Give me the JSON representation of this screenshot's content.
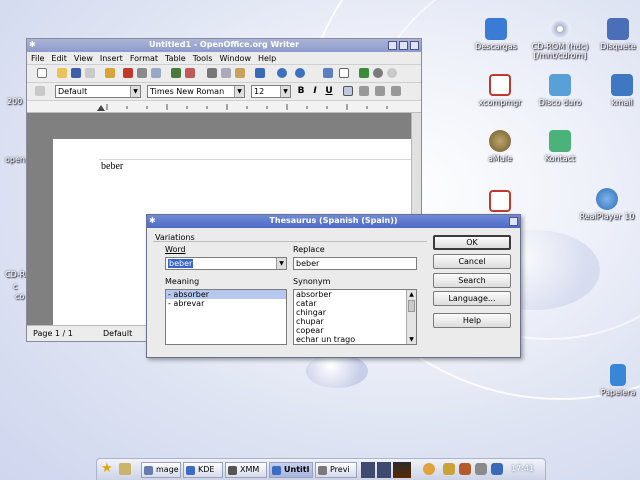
{
  "desktop": {
    "icons": [
      {
        "label": "Descargas",
        "icon": "folder-download-icon",
        "color": "#3a7bd5"
      },
      {
        "label": "CD-ROM (hdc)\n[/mnt/cdrom]",
        "icon": "cdrom-icon",
        "color": "#8aa0c8"
      },
      {
        "label": "Disquete",
        "icon": "floppy-icon",
        "color": "#4a6fb8"
      },
      {
        "label": "xcompmgr",
        "icon": "app-icon",
        "color": "#c0392b"
      },
      {
        "label": "Disco duro",
        "icon": "harddisk-icon",
        "color": "#5aa0d8"
      },
      {
        "label": "kmail",
        "icon": "mail-icon",
        "color": "#3e78c2"
      },
      {
        "label": "aMule",
        "icon": "mule-icon",
        "color": "#7a6a3a"
      },
      {
        "label": "Kontact",
        "icon": "kontact-icon",
        "color": "#4bb37a"
      },
      {
        "label": "RealPlayer 10",
        "icon": "realplayer-icon",
        "color": "#2d6fb7"
      },
      {
        "label": "Papelera",
        "icon": "trash-icon",
        "color": "#3a86d6"
      }
    ],
    "edge_labels": [
      "200",
      "open",
      "CD-R",
      "c",
      "co"
    ]
  },
  "writer": {
    "title": "Untitled1 - OpenOffice.org Writer",
    "menu": [
      "File",
      "Edit",
      "View",
      "Insert",
      "Format",
      "Table",
      "Tools",
      "Window",
      "Help"
    ],
    "style_value": "Default",
    "font_value": "Times New Roman",
    "size_value": "12",
    "format_buttons": [
      "B",
      "I",
      "U"
    ],
    "document_text": "beber",
    "status_page": "Page 1 / 1",
    "status_style": "Default"
  },
  "thesaurus": {
    "title": "Thesaurus (Spanish (Spain))",
    "group_label": "Variations",
    "word_label": "Word",
    "word_value": "beber",
    "replace_label": "Replace",
    "replace_value": "beber",
    "meaning_label": "Meaning",
    "meanings": [
      "- absorber",
      "- abrevar"
    ],
    "synonym_label": "Synonym",
    "synonyms": [
      "absorber",
      "catar",
      "chingar",
      "chupar",
      "copear",
      "echar un trago"
    ],
    "buttons": {
      "ok": "OK",
      "cancel": "Cancel",
      "search": "Search",
      "language": "Language...",
      "help": "Help"
    }
  },
  "taskbar": {
    "items": [
      {
        "label": "mage",
        "active": false,
        "color": "#6a7bb0"
      },
      {
        "label": "KDE",
        "active": false,
        "color": "#3b6dc5"
      },
      {
        "label": "XMM",
        "active": false,
        "color": "#555555"
      },
      {
        "label": "Untitl",
        "active": true,
        "color": "#3b6dc5"
      },
      {
        "label": "Previ",
        "active": false,
        "color": "#7a7a7a"
      }
    ],
    "clock": "17:41"
  }
}
